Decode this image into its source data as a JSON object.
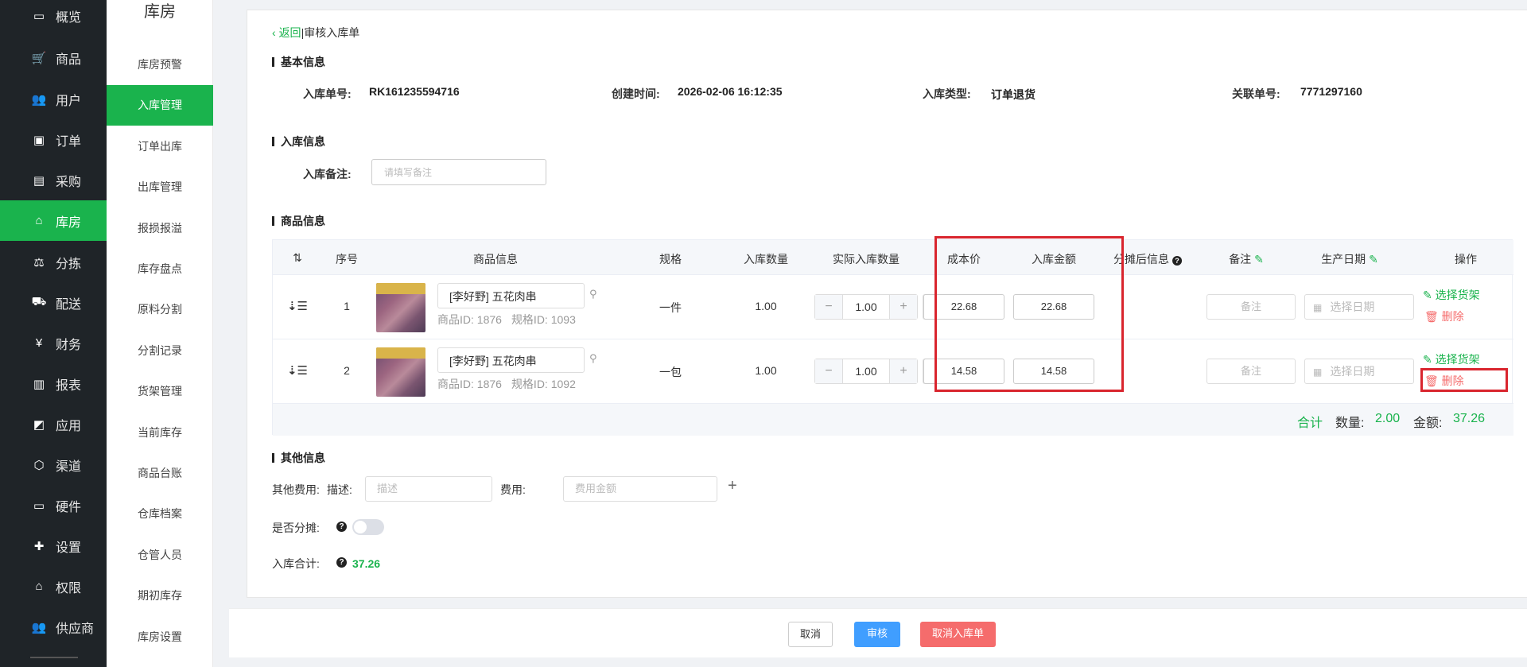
{
  "nav_primary": [
    {
      "label": "概览",
      "icon": "monitor-icon",
      "glyph": "▭"
    },
    {
      "label": "商品",
      "icon": "cart-icon",
      "glyph": "🛒"
    },
    {
      "label": "用户",
      "icon": "users-icon",
      "glyph": "👥"
    },
    {
      "label": "订单",
      "icon": "money-icon",
      "glyph": "▣"
    },
    {
      "label": "采购",
      "icon": "bus-icon",
      "glyph": "▤"
    },
    {
      "label": "库房",
      "icon": "home-icon",
      "glyph": "⌂"
    },
    {
      "label": "分拣",
      "icon": "scale-icon",
      "glyph": "⚖"
    },
    {
      "label": "配送",
      "icon": "truck-icon",
      "glyph": "⛟"
    },
    {
      "label": "财务",
      "icon": "yen-icon",
      "glyph": "¥"
    },
    {
      "label": "报表",
      "icon": "bar-chart-icon",
      "glyph": "▥"
    },
    {
      "label": "应用",
      "icon": "apps-icon",
      "glyph": "◩"
    },
    {
      "label": "渠道",
      "icon": "cube-icon",
      "glyph": "⬡"
    },
    {
      "label": "硬件",
      "icon": "desktop-icon",
      "glyph": "▭"
    },
    {
      "label": "设置",
      "icon": "puzzle-icon",
      "glyph": "✚"
    },
    {
      "label": "权限",
      "icon": "bank-icon",
      "glyph": "⌂"
    },
    {
      "label": "供应商",
      "icon": "group-icon",
      "glyph": "👥"
    }
  ],
  "nav_secondary": {
    "title": "库房",
    "items": [
      "库房预警",
      "入库管理",
      "订单出库",
      "出库管理",
      "报损报溢",
      "库存盘点",
      "原料分割",
      "分割记录",
      "货架管理",
      "当前库存",
      "商品台账",
      "仓库档案",
      "仓管人员",
      "期初库存",
      "库房设置"
    ]
  },
  "header": {
    "back_label": "返回",
    "page_title": "审核入库单"
  },
  "basic_info": {
    "title": "基本信息",
    "order_no_label": "入库单号:",
    "order_no": "RK161235594716",
    "created_label": "创建时间:",
    "created": "2026-02-06 16:12:35",
    "type_label": "入库类型:",
    "type": "订单退货",
    "related_label": "关联单号:",
    "related": "7771297160"
  },
  "stock_in_info": {
    "title": "入库信息",
    "remark_label": "入库备注:",
    "remark_placeholder": "请填写备注"
  },
  "goods_info": {
    "title": "商品信息",
    "columns": {
      "sort": "⇅",
      "index": "序号",
      "product": "商品信息",
      "spec": "规格",
      "qty": "入库数量",
      "actual_qty": "实际入库数量",
      "cost": "成本价",
      "amount": "入库金额",
      "alloc": "分摊后信息",
      "note": "备注",
      "date": "生产日期",
      "ops": "操作"
    },
    "rows": [
      {
        "index": "1",
        "name": "[李好野] 五花肉串",
        "product_id": "商品ID:  1876",
        "spec_id": "规格ID:  1093",
        "spec": "一件",
        "qty": "1.00",
        "actual": "1.00",
        "cost": "22.68",
        "amount": "22.68",
        "note_placeholder": "备注",
        "date_placeholder": "选择日期",
        "choose": "选择货架",
        "delete": "删除"
      },
      {
        "index": "2",
        "name": "[李好野] 五花肉串",
        "product_id": "商品ID:  1876",
        "spec_id": "规格ID:  1092",
        "spec": "一包",
        "qty": "1.00",
        "actual": "1.00",
        "cost": "14.58",
        "amount": "14.58",
        "note_placeholder": "备注",
        "date_placeholder": "选择日期",
        "choose": "选择货架",
        "delete": "删除"
      }
    ],
    "total_label": "合计",
    "total_qty_label": "数量:",
    "total_qty": "2.00",
    "total_amount_label": "金额:",
    "total_amount": "37.26"
  },
  "other_info": {
    "title": "其他信息",
    "fee_label": "其他费用:",
    "desc_label": "描述:",
    "desc_placeholder": "描述",
    "fee_amount_label": "费用:",
    "fee_placeholder": "费用金额",
    "alloc_label": "是否分摊:",
    "total_label": "入库合计:",
    "total": "37.26"
  },
  "actions": {
    "cancel": "取消",
    "approve": "审核",
    "void": "取消入库单"
  },
  "colors": {
    "accent": "#1ab34d",
    "danger": "#f56c6c",
    "primary": "#409eff",
    "highlight": "#d9252e"
  }
}
